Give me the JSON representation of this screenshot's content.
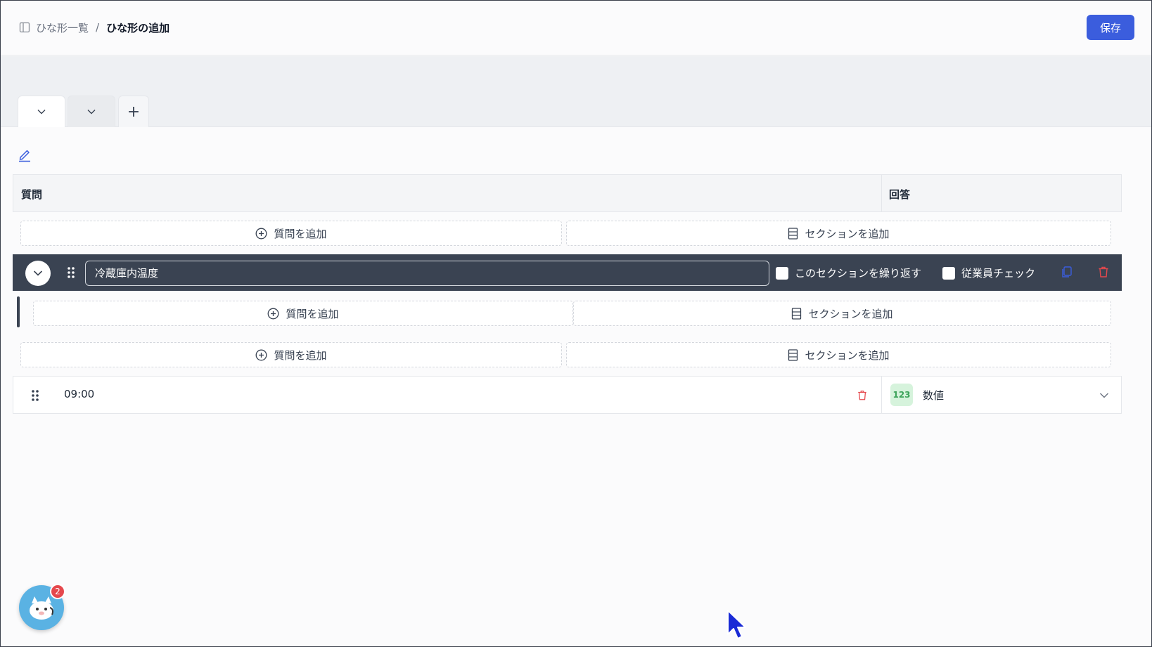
{
  "header": {
    "breadcrumb": {
      "parent_label": "ひな形一覧",
      "separator": "/",
      "current_label": "ひな形の追加"
    },
    "save_label": "保存"
  },
  "tabs": {
    "items": [
      {
        "label": ""
      },
      {
        "label": ""
      }
    ],
    "add_symbol": "+"
  },
  "table": {
    "headers": {
      "question": "質問",
      "answer": "回答"
    },
    "add_question_label": "質問を追加",
    "add_section_label": "セクションを追加",
    "section": {
      "name": "冷蔵庫内温度",
      "repeat_label": "このセクションを繰り返す",
      "employee_check_label": "従業員チェック"
    },
    "question_row": {
      "text": "09:00",
      "type_badge": "123",
      "type_label": "数値"
    }
  },
  "chat": {
    "unread_count": "2"
  },
  "colors": {
    "primary": "#3b5ddd",
    "section_bar": "#3a4352",
    "danger": "#e5484d",
    "number_badge_bg": "#d6f3dc"
  }
}
